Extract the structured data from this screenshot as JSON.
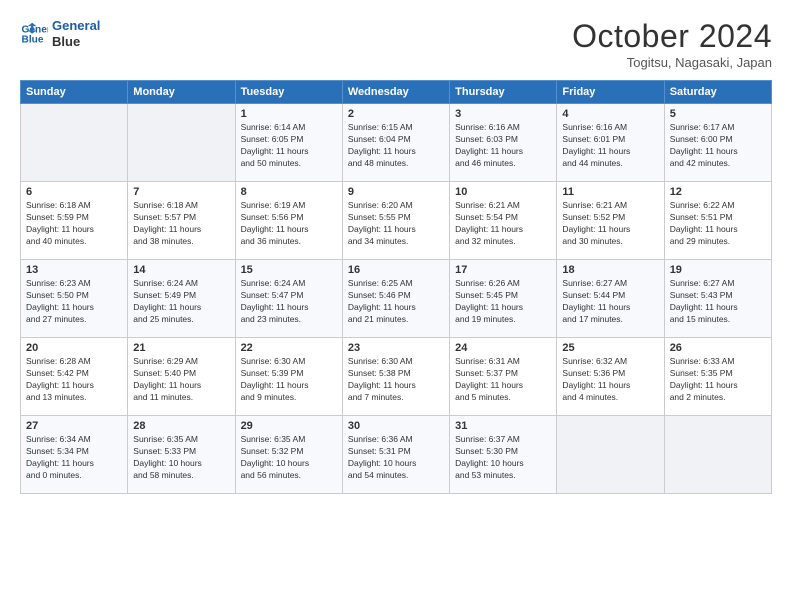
{
  "header": {
    "logo_line1": "General",
    "logo_line2": "Blue",
    "month": "October 2024",
    "location": "Togitsu, Nagasaki, Japan"
  },
  "days_of_week": [
    "Sunday",
    "Monday",
    "Tuesday",
    "Wednesday",
    "Thursday",
    "Friday",
    "Saturday"
  ],
  "weeks": [
    [
      {
        "day": "",
        "info": ""
      },
      {
        "day": "",
        "info": ""
      },
      {
        "day": "1",
        "info": "Sunrise: 6:14 AM\nSunset: 6:05 PM\nDaylight: 11 hours\nand 50 minutes."
      },
      {
        "day": "2",
        "info": "Sunrise: 6:15 AM\nSunset: 6:04 PM\nDaylight: 11 hours\nand 48 minutes."
      },
      {
        "day": "3",
        "info": "Sunrise: 6:16 AM\nSunset: 6:03 PM\nDaylight: 11 hours\nand 46 minutes."
      },
      {
        "day": "4",
        "info": "Sunrise: 6:16 AM\nSunset: 6:01 PM\nDaylight: 11 hours\nand 44 minutes."
      },
      {
        "day": "5",
        "info": "Sunrise: 6:17 AM\nSunset: 6:00 PM\nDaylight: 11 hours\nand 42 minutes."
      }
    ],
    [
      {
        "day": "6",
        "info": "Sunrise: 6:18 AM\nSunset: 5:59 PM\nDaylight: 11 hours\nand 40 minutes."
      },
      {
        "day": "7",
        "info": "Sunrise: 6:18 AM\nSunset: 5:57 PM\nDaylight: 11 hours\nand 38 minutes."
      },
      {
        "day": "8",
        "info": "Sunrise: 6:19 AM\nSunset: 5:56 PM\nDaylight: 11 hours\nand 36 minutes."
      },
      {
        "day": "9",
        "info": "Sunrise: 6:20 AM\nSunset: 5:55 PM\nDaylight: 11 hours\nand 34 minutes."
      },
      {
        "day": "10",
        "info": "Sunrise: 6:21 AM\nSunset: 5:54 PM\nDaylight: 11 hours\nand 32 minutes."
      },
      {
        "day": "11",
        "info": "Sunrise: 6:21 AM\nSunset: 5:52 PM\nDaylight: 11 hours\nand 30 minutes."
      },
      {
        "day": "12",
        "info": "Sunrise: 6:22 AM\nSunset: 5:51 PM\nDaylight: 11 hours\nand 29 minutes."
      }
    ],
    [
      {
        "day": "13",
        "info": "Sunrise: 6:23 AM\nSunset: 5:50 PM\nDaylight: 11 hours\nand 27 minutes."
      },
      {
        "day": "14",
        "info": "Sunrise: 6:24 AM\nSunset: 5:49 PM\nDaylight: 11 hours\nand 25 minutes."
      },
      {
        "day": "15",
        "info": "Sunrise: 6:24 AM\nSunset: 5:47 PM\nDaylight: 11 hours\nand 23 minutes."
      },
      {
        "day": "16",
        "info": "Sunrise: 6:25 AM\nSunset: 5:46 PM\nDaylight: 11 hours\nand 21 minutes."
      },
      {
        "day": "17",
        "info": "Sunrise: 6:26 AM\nSunset: 5:45 PM\nDaylight: 11 hours\nand 19 minutes."
      },
      {
        "day": "18",
        "info": "Sunrise: 6:27 AM\nSunset: 5:44 PM\nDaylight: 11 hours\nand 17 minutes."
      },
      {
        "day": "19",
        "info": "Sunrise: 6:27 AM\nSunset: 5:43 PM\nDaylight: 11 hours\nand 15 minutes."
      }
    ],
    [
      {
        "day": "20",
        "info": "Sunrise: 6:28 AM\nSunset: 5:42 PM\nDaylight: 11 hours\nand 13 minutes."
      },
      {
        "day": "21",
        "info": "Sunrise: 6:29 AM\nSunset: 5:40 PM\nDaylight: 11 hours\nand 11 minutes."
      },
      {
        "day": "22",
        "info": "Sunrise: 6:30 AM\nSunset: 5:39 PM\nDaylight: 11 hours\nand 9 minutes."
      },
      {
        "day": "23",
        "info": "Sunrise: 6:30 AM\nSunset: 5:38 PM\nDaylight: 11 hours\nand 7 minutes."
      },
      {
        "day": "24",
        "info": "Sunrise: 6:31 AM\nSunset: 5:37 PM\nDaylight: 11 hours\nand 5 minutes."
      },
      {
        "day": "25",
        "info": "Sunrise: 6:32 AM\nSunset: 5:36 PM\nDaylight: 11 hours\nand 4 minutes."
      },
      {
        "day": "26",
        "info": "Sunrise: 6:33 AM\nSunset: 5:35 PM\nDaylight: 11 hours\nand 2 minutes."
      }
    ],
    [
      {
        "day": "27",
        "info": "Sunrise: 6:34 AM\nSunset: 5:34 PM\nDaylight: 11 hours\nand 0 minutes."
      },
      {
        "day": "28",
        "info": "Sunrise: 6:35 AM\nSunset: 5:33 PM\nDaylight: 10 hours\nand 58 minutes."
      },
      {
        "day": "29",
        "info": "Sunrise: 6:35 AM\nSunset: 5:32 PM\nDaylight: 10 hours\nand 56 minutes."
      },
      {
        "day": "30",
        "info": "Sunrise: 6:36 AM\nSunset: 5:31 PM\nDaylight: 10 hours\nand 54 minutes."
      },
      {
        "day": "31",
        "info": "Sunrise: 6:37 AM\nSunset: 5:30 PM\nDaylight: 10 hours\nand 53 minutes."
      },
      {
        "day": "",
        "info": ""
      },
      {
        "day": "",
        "info": ""
      }
    ]
  ]
}
